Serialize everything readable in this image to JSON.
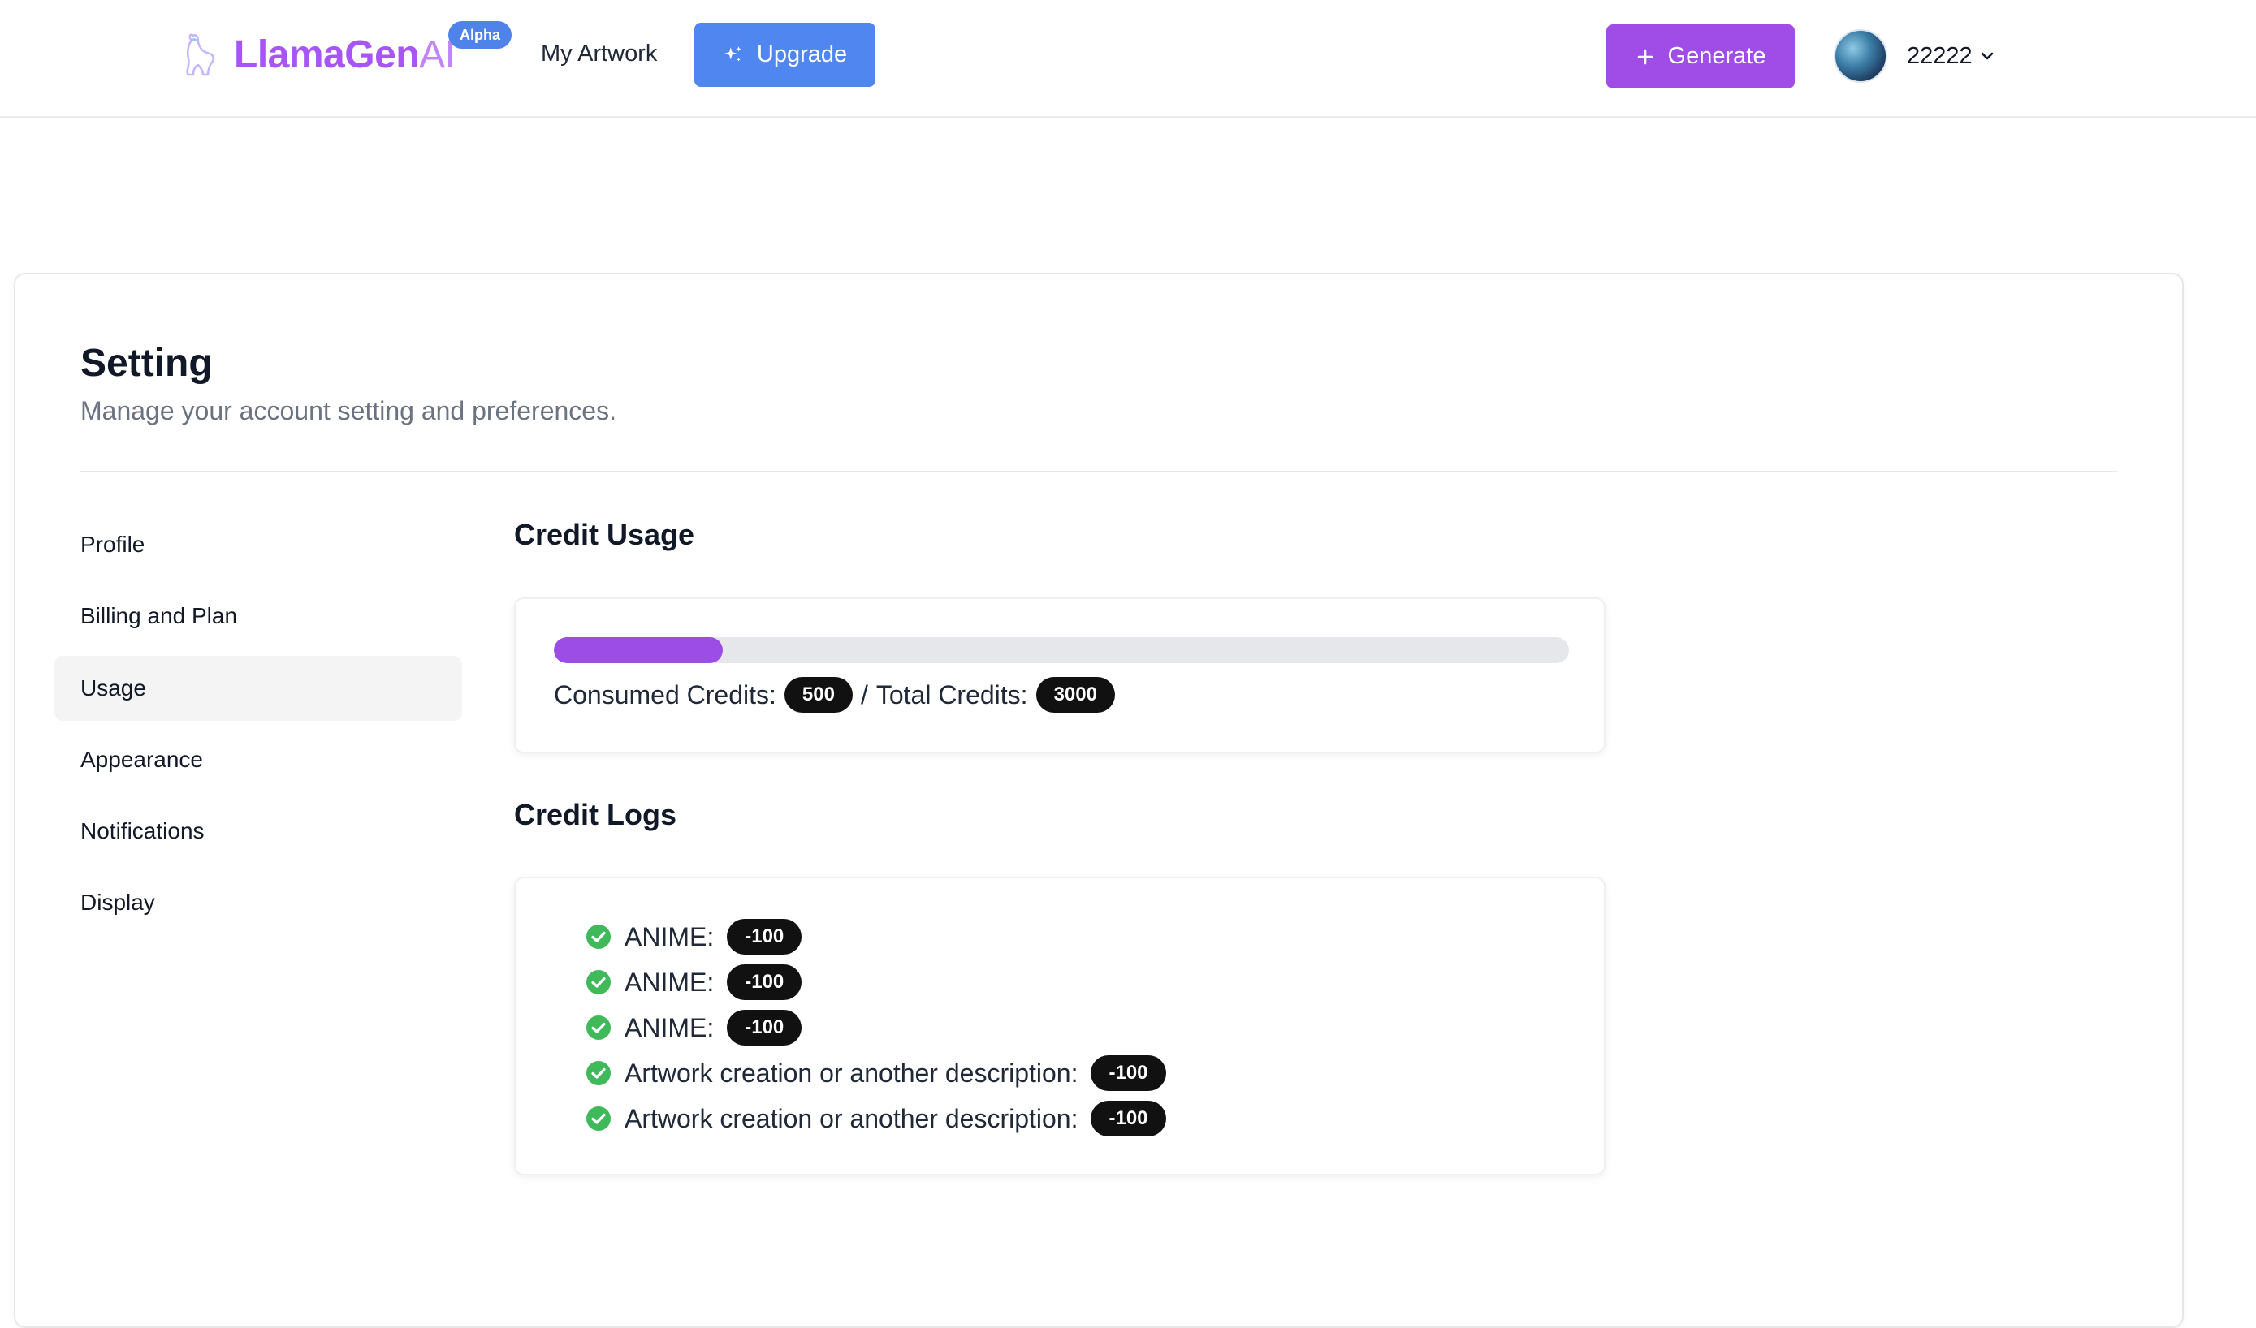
{
  "header": {
    "logo_main": "LlamaGen",
    "logo_suffix": "AI",
    "badge": "Alpha",
    "nav_my_artwork": "My Artwork",
    "upgrade_label": "Upgrade",
    "generate_label": "Generate",
    "username": "22222"
  },
  "page": {
    "title": "Setting",
    "subtitle": "Manage your account setting and preferences."
  },
  "sidebar": {
    "items": [
      {
        "label": "Profile"
      },
      {
        "label": "Billing and Plan"
      },
      {
        "label": "Usage",
        "active": true
      },
      {
        "label": "Appearance"
      },
      {
        "label": "Notifications"
      },
      {
        "label": "Display"
      }
    ]
  },
  "usage": {
    "title": "Credit Usage",
    "consumed_label": "Consumed Credits:",
    "consumed_value": "500",
    "separator": "/",
    "total_label": "Total Credits:",
    "total_value": "3000",
    "progress_fraction": 0.1667
  },
  "logs": {
    "title": "Credit Logs",
    "entries": [
      {
        "label": "ANIME:",
        "amount": "-100"
      },
      {
        "label": "ANIME:",
        "amount": "-100"
      },
      {
        "label": "ANIME:",
        "amount": "-100"
      },
      {
        "label": "Artwork creation or another description:",
        "amount": "-100"
      },
      {
        "label": "Artwork creation or another description:",
        "amount": "-100"
      }
    ]
  },
  "colors": {
    "brand_purple": "#a855f7",
    "upgrade_blue": "#4f86f0",
    "generate_purple": "#a04de8",
    "progress_fill": "#9b4de6",
    "success_green": "#3fb95a"
  },
  "icons": [
    "llama-logo-icon",
    "sparkles-icon",
    "plus-icon",
    "chevron-down-icon",
    "check-circle-icon"
  ]
}
